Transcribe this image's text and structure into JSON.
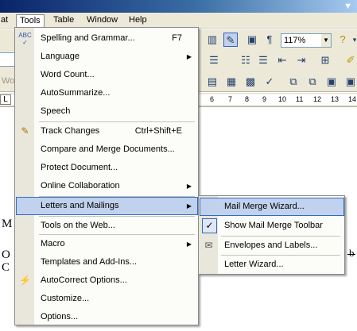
{
  "menubar": {
    "items": [
      {
        "label": "at",
        "active": false
      },
      {
        "label": "Tools",
        "active": true
      },
      {
        "label": "Table",
        "active": false
      },
      {
        "label": "Window",
        "active": false
      },
      {
        "label": "Help",
        "active": false
      }
    ]
  },
  "toolbar": {
    "zoom": "117%",
    "left_fragment": "Wo"
  },
  "ruler": {
    "numbers": [
      "6",
      "7",
      "8",
      "9",
      "10",
      "11",
      "12",
      "13",
      "14"
    ]
  },
  "document": {
    "fragment_1": "M",
    "fragment_2": "O",
    "fragment_3": "C",
    "fragment_4": "b"
  },
  "tools_menu": {
    "items": [
      {
        "label": "Spelling and Grammar...",
        "shortcut": "F7",
        "icon": "spelling-abc-icon"
      },
      {
        "label": "Language",
        "submenu": true
      },
      {
        "label": "Word Count..."
      },
      {
        "label": "AutoSummarize..."
      },
      {
        "label": "Speech"
      },
      {
        "label": "Track Changes",
        "shortcut": "Ctrl+Shift+E",
        "icon": "track-changes-icon"
      },
      {
        "label": "Compare and Merge Documents..."
      },
      {
        "label": "Protect Document..."
      },
      {
        "label": "Online Collaboration",
        "submenu": true
      },
      {
        "label": "Letters and Mailings",
        "submenu": true,
        "highlighted": true
      },
      {
        "label": "Tools on the Web..."
      },
      {
        "label": "Macro",
        "submenu": true
      },
      {
        "label": "Templates and Add-Ins..."
      },
      {
        "label": "AutoCorrect Options...",
        "icon": "autocorrect-lightning-icon"
      },
      {
        "label": "Customize..."
      },
      {
        "label": "Options..."
      }
    ]
  },
  "submenu": {
    "items": [
      {
        "label": "Mail Merge Wizard...",
        "highlighted": true
      },
      {
        "label": "Show Mail Merge Toolbar",
        "checked": true
      },
      {
        "label": "Envelopes and Labels...",
        "icon": "envelope-icon"
      },
      {
        "label": "Letter Wizard..."
      }
    ]
  },
  "colors": {
    "highlight": "#c1d2ee",
    "highlight_border": "#316ac5",
    "menubar_bg": "#ece9d8",
    "menu_bg": "#fcfcf9"
  }
}
